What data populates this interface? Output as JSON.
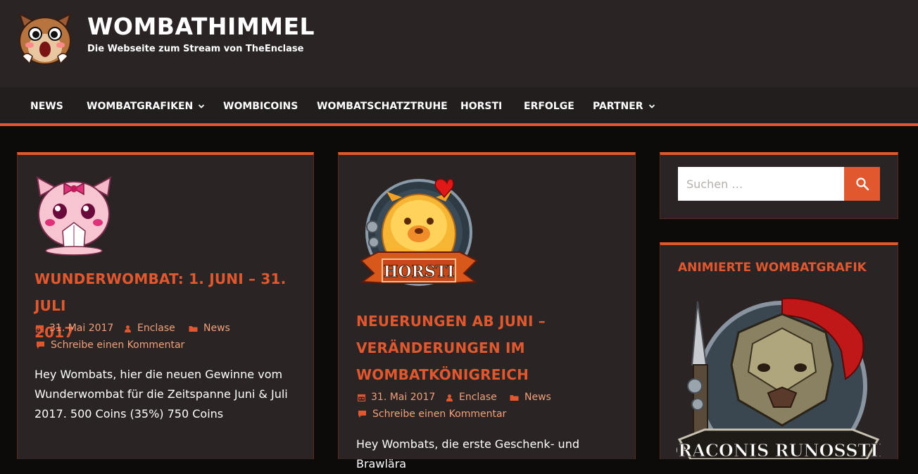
{
  "site": {
    "title": "WOMBATHIMMEL",
    "description": "Die Webseite zum Stream von TheEnclase"
  },
  "nav": {
    "items": [
      {
        "label": "NEWS",
        "has_submenu": false
      },
      {
        "label": "WOMBATGRAFIKEN",
        "has_submenu": true
      },
      {
        "label": "WOMBICOINS",
        "has_submenu": false
      },
      {
        "label": "WOMBATSCHATZTRUHE",
        "has_submenu": false
      },
      {
        "label": "HORSTI",
        "has_submenu": false
      },
      {
        "label": "ERFOLGE",
        "has_submenu": false
      },
      {
        "label": "PARTNER",
        "has_submenu": true
      }
    ]
  },
  "posts": [
    {
      "title_line1": "WUNDERWOMBAT: 1. JUNI – 31. JULI",
      "title_line2": "2017",
      "date": "31. Mai 2017",
      "author": "Enclase",
      "category": "News",
      "comment_link": "Schreibe einen Kommentar",
      "excerpt_line1": "Hey Wombats, hier die neuen Gewinne vom",
      "excerpt_line2": "Wunderwombat für die Zeitspanne Juni & Juli",
      "excerpt_line3": "2017. 500 Coins (35%) 750 Coins"
    },
    {
      "image_label": "HORSTI",
      "title_line1": "NEUERUNGEN AB JUNI –",
      "title_line2": "VERÄNDERUNGEN IM",
      "title_line3": "WOMBATKÖNIGREICH",
      "date": "31. Mai 2017",
      "author": "Enclase",
      "category": "News",
      "comment_link": "Schreibe einen Kommentar",
      "excerpt_line1": "Hey Wombats, die erste Geschenk- und Brawlära"
    }
  ],
  "sidebar": {
    "search_placeholder": "Suchen …",
    "widget_title": "ANIMIERTE WOMBATGRAFIK",
    "widget_image_label": "DRACONIS RUNOSSTIN"
  },
  "colors": {
    "accent": "#e1582f",
    "background": "#0d0a0a",
    "panel": "#2a2424",
    "meta_text": "#f3a07a"
  }
}
